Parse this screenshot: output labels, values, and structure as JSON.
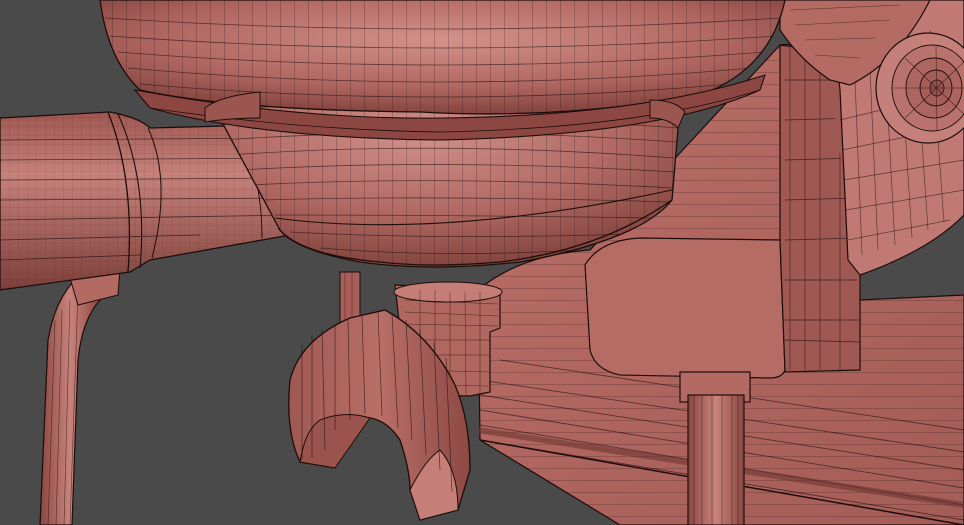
{
  "viewport": {
    "background_color": "#4a4a4a",
    "mesh_color": "#b86a63",
    "mesh_shadow_color": "#8a4640",
    "mesh_highlight_color": "#d3928a",
    "wire_color": "#1c0d0b"
  },
  "objects": [
    {
      "name": "group-head-bowl"
    },
    {
      "name": "portafilter-basket"
    },
    {
      "name": "portafilter-handle"
    },
    {
      "name": "pipe-tube"
    },
    {
      "name": "cup-holder-fork"
    },
    {
      "name": "spout-nozzle"
    },
    {
      "name": "machine-body-panel"
    },
    {
      "name": "side-column"
    },
    {
      "name": "dial-knob"
    },
    {
      "name": "support-leg"
    }
  ]
}
